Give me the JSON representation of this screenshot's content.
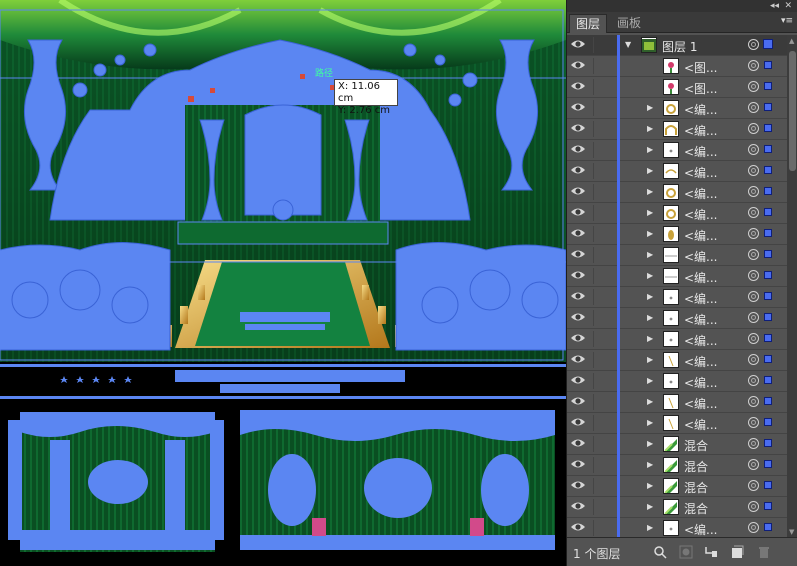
{
  "panel": {
    "collapse_control": "◂◂",
    "close_control": "✕",
    "tabs": [
      {
        "label": "图层",
        "active": true
      },
      {
        "label": "画板",
        "active": false
      }
    ],
    "menu_icon": "panel-menu-icon",
    "layer_color": "#4a6cf0",
    "rows": [
      {
        "name": "图层 1",
        "thumb": "layer",
        "expand": "expanded",
        "selected": true
      },
      {
        "name": "<图...",
        "thumb": "flower",
        "expand": "none"
      },
      {
        "name": "<图...",
        "thumb": "flower",
        "expand": "none"
      },
      {
        "name": "<编...",
        "thumb": "ring",
        "expand": "collapsed"
      },
      {
        "name": "<编...",
        "thumb": "arch",
        "expand": "collapsed"
      },
      {
        "name": "<编...",
        "thumb": "dots",
        "expand": "collapsed"
      },
      {
        "name": "<编...",
        "thumb": "arc",
        "expand": "collapsed"
      },
      {
        "name": "<编...",
        "thumb": "ring",
        "expand": "collapsed"
      },
      {
        "name": "<编...",
        "thumb": "ring",
        "expand": "collapsed"
      },
      {
        "name": "<编...",
        "thumb": "oval",
        "expand": "collapsed"
      },
      {
        "name": "<编...",
        "thumb": "line",
        "expand": "collapsed"
      },
      {
        "name": "<编...",
        "thumb": "line",
        "expand": "collapsed"
      },
      {
        "name": "<编...",
        "thumb": "dots",
        "expand": "collapsed"
      },
      {
        "name": "<编...",
        "thumb": "dots",
        "expand": "collapsed"
      },
      {
        "name": "<编...",
        "thumb": "dots",
        "expand": "collapsed"
      },
      {
        "name": "<编...",
        "thumb": "stroke",
        "expand": "collapsed"
      },
      {
        "name": "<编...",
        "thumb": "dots",
        "expand": "collapsed"
      },
      {
        "name": "<编...",
        "thumb": "stroke",
        "expand": "collapsed"
      },
      {
        "name": "<编...",
        "thumb": "stroke",
        "expand": "collapsed"
      },
      {
        "name": "混合",
        "thumb": "blend",
        "expand": "collapsed"
      },
      {
        "name": "混合",
        "thumb": "blend",
        "expand": "collapsed"
      },
      {
        "name": "混合",
        "thumb": "blend",
        "expand": "collapsed"
      },
      {
        "name": "混合",
        "thumb": "blend",
        "expand": "collapsed"
      },
      {
        "name": "<编...",
        "thumb": "dots",
        "expand": "collapsed"
      }
    ],
    "footer": {
      "count_label": "1 个图层",
      "icons": [
        "locate-object-icon",
        "make-clipping-mask-icon",
        "create-sublayer-icon",
        "new-layer-icon",
        "delete-layer-icon"
      ]
    }
  },
  "canvas": {
    "measure_tooltip": {
      "x": "X: 11.06 cm",
      "y": "Y: 2.76 cm"
    },
    "smart_guide_label": "路径",
    "colors": {
      "selection": "#5b86f2",
      "stage_green": "#0a6a32",
      "carpet": "#138240",
      "gold": "#d4a640"
    }
  }
}
